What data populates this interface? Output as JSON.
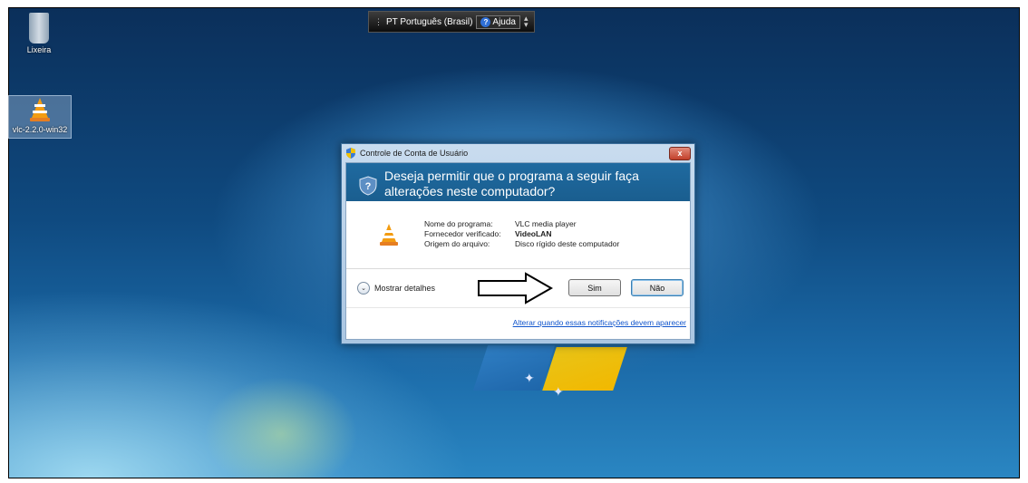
{
  "desktop": {
    "icons": [
      {
        "label": "Lixeira"
      },
      {
        "label": "vlc-2.2.0-win32"
      }
    ]
  },
  "langbar": {
    "language": "PT Português (Brasil)",
    "help_label": "Ajuda"
  },
  "dialog": {
    "title": "Controle de Conta de Usuário",
    "close_label": "x",
    "question": "Deseja permitir que o programa a seguir faça alterações neste computador?",
    "info": [
      {
        "label": "Nome do programa:",
        "value": "VLC media player"
      },
      {
        "label": "Fornecedor verificado:",
        "value": "VideoLAN"
      },
      {
        "label": "Origem do arquivo:",
        "value": "Disco rígido deste computador"
      }
    ],
    "details_label": "Mostrar detalhes",
    "yes_label": "Sim",
    "no_label": "Não",
    "settings_link": "Alterar quando essas notificações devem aparecer"
  },
  "colors": {
    "banner": "#1f6aa0",
    "link": "#1155cc",
    "close": "#c2402b"
  }
}
